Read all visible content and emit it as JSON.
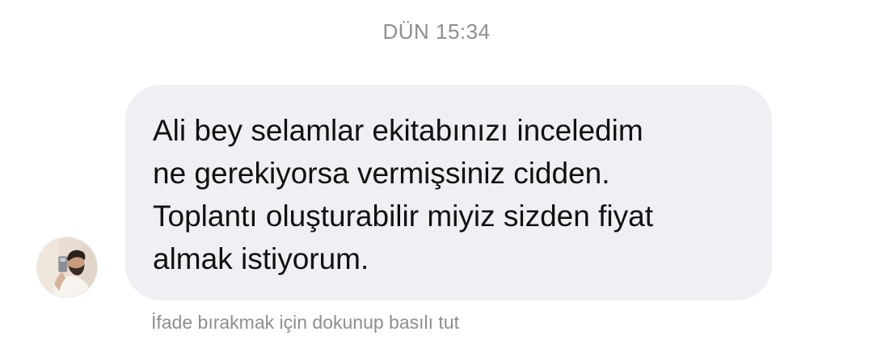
{
  "conversation": {
    "timestamp": "DÜN 15:34"
  },
  "message": {
    "text": "Ali bey selamlar ekitabınızı inceledim\nne gerekiyorsa vermişsiniz cidden.\nToplantı oluşturabilir miyiz sizden fiyat\nalmak istiyorum.",
    "bubble_color": "#efeff4",
    "text_color": "#111111"
  },
  "reaction_hint": "İfade bırakmak için dokunup basılı tut",
  "colors": {
    "secondary_text": "#8e8e93",
    "background": "#ffffff"
  }
}
